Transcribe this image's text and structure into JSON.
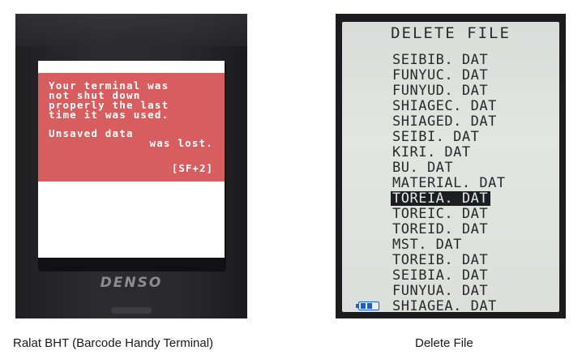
{
  "left_device": {
    "error_message_lines": [
      "Your terminal was",
      "not shut down",
      "properly the last",
      "time it was used."
    ],
    "error_detail_lines": [
      "Unsaved data",
      "was lost."
    ],
    "error_code": "[SF+2]",
    "brand": "DENSO",
    "colors": {
      "error_panel": "#d75d5f",
      "error_text": "#ffffff"
    }
  },
  "right_device": {
    "title": "DELETE FILE",
    "files": [
      "SEIBIB. DAT",
      "FUNYUC. DAT",
      "FUNYUD. DAT",
      "SHIAGEC. DAT",
      "SHIAGED. DAT",
      "SEIBI. DAT",
      "KIRI. DAT",
      "BU. DAT",
      "MATERIAL. DAT",
      "TOREIA. DAT",
      "TOREIC. DAT",
      "TOREID. DAT",
      "MST. DAT",
      "TOREIB. DAT",
      "SEIBIA. DAT",
      "FUNYUA. DAT",
      "SHIAGEA. DAT"
    ],
    "selected_index": 9,
    "battery_icon": "battery-icon",
    "colors": {
      "battery": "#1f5fc0",
      "selection_bg": "#1d1d22"
    }
  },
  "captions": {
    "left": "Ralat BHT (Barcode Handy Terminal)",
    "right": "Delete File"
  }
}
